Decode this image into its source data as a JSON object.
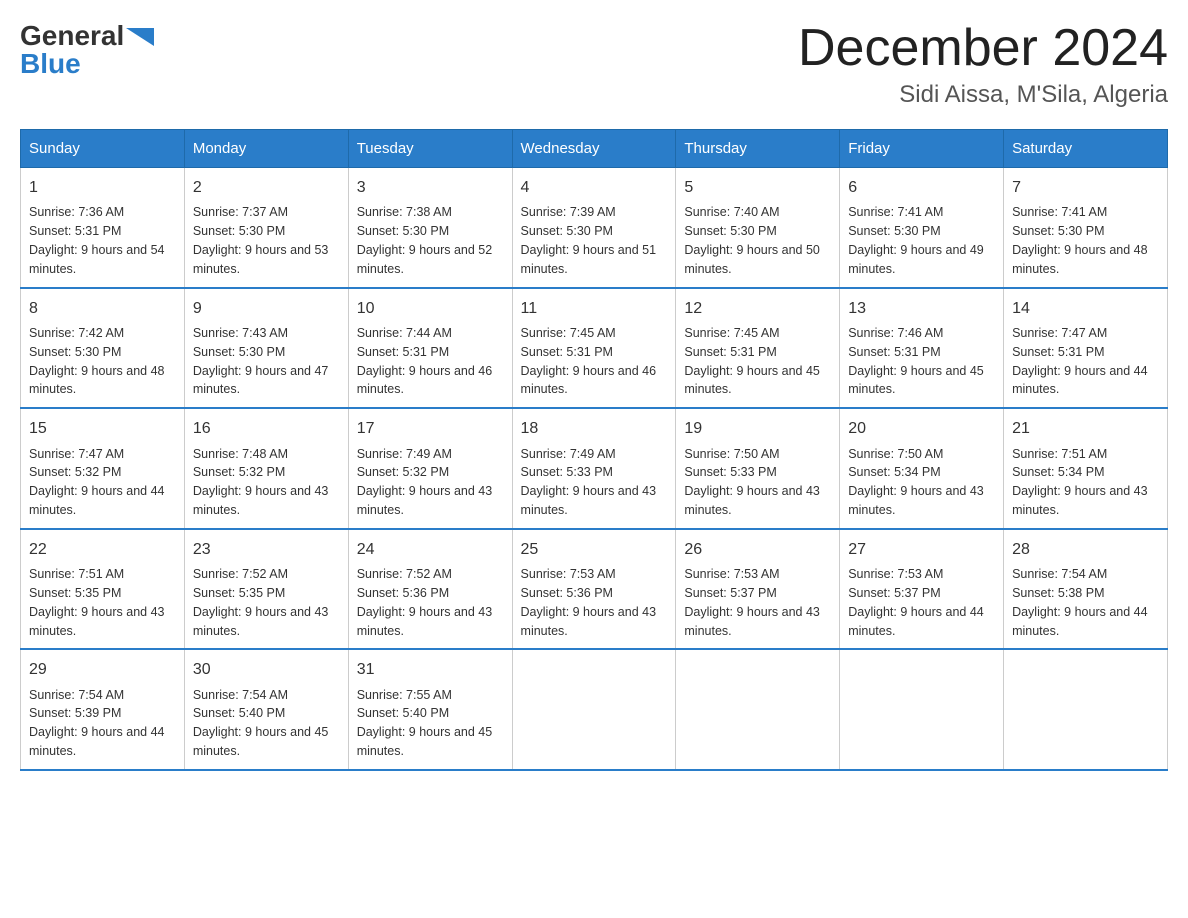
{
  "logo": {
    "general": "General",
    "blue": "Blue"
  },
  "title": "December 2024",
  "subtitle": "Sidi Aissa, M'Sila, Algeria",
  "days_header": [
    "Sunday",
    "Monday",
    "Tuesday",
    "Wednesday",
    "Thursday",
    "Friday",
    "Saturday"
  ],
  "weeks": [
    [
      {
        "day": "1",
        "sunrise": "7:36 AM",
        "sunset": "5:31 PM",
        "daylight": "9 hours and 54 minutes."
      },
      {
        "day": "2",
        "sunrise": "7:37 AM",
        "sunset": "5:30 PM",
        "daylight": "9 hours and 53 minutes."
      },
      {
        "day": "3",
        "sunrise": "7:38 AM",
        "sunset": "5:30 PM",
        "daylight": "9 hours and 52 minutes."
      },
      {
        "day": "4",
        "sunrise": "7:39 AM",
        "sunset": "5:30 PM",
        "daylight": "9 hours and 51 minutes."
      },
      {
        "day": "5",
        "sunrise": "7:40 AM",
        "sunset": "5:30 PM",
        "daylight": "9 hours and 50 minutes."
      },
      {
        "day": "6",
        "sunrise": "7:41 AM",
        "sunset": "5:30 PM",
        "daylight": "9 hours and 49 minutes."
      },
      {
        "day": "7",
        "sunrise": "7:41 AM",
        "sunset": "5:30 PM",
        "daylight": "9 hours and 48 minutes."
      }
    ],
    [
      {
        "day": "8",
        "sunrise": "7:42 AM",
        "sunset": "5:30 PM",
        "daylight": "9 hours and 48 minutes."
      },
      {
        "day": "9",
        "sunrise": "7:43 AM",
        "sunset": "5:30 PM",
        "daylight": "9 hours and 47 minutes."
      },
      {
        "day": "10",
        "sunrise": "7:44 AM",
        "sunset": "5:31 PM",
        "daylight": "9 hours and 46 minutes."
      },
      {
        "day": "11",
        "sunrise": "7:45 AM",
        "sunset": "5:31 PM",
        "daylight": "9 hours and 46 minutes."
      },
      {
        "day": "12",
        "sunrise": "7:45 AM",
        "sunset": "5:31 PM",
        "daylight": "9 hours and 45 minutes."
      },
      {
        "day": "13",
        "sunrise": "7:46 AM",
        "sunset": "5:31 PM",
        "daylight": "9 hours and 45 minutes."
      },
      {
        "day": "14",
        "sunrise": "7:47 AM",
        "sunset": "5:31 PM",
        "daylight": "9 hours and 44 minutes."
      }
    ],
    [
      {
        "day": "15",
        "sunrise": "7:47 AM",
        "sunset": "5:32 PM",
        "daylight": "9 hours and 44 minutes."
      },
      {
        "day": "16",
        "sunrise": "7:48 AM",
        "sunset": "5:32 PM",
        "daylight": "9 hours and 43 minutes."
      },
      {
        "day": "17",
        "sunrise": "7:49 AM",
        "sunset": "5:32 PM",
        "daylight": "9 hours and 43 minutes."
      },
      {
        "day": "18",
        "sunrise": "7:49 AM",
        "sunset": "5:33 PM",
        "daylight": "9 hours and 43 minutes."
      },
      {
        "day": "19",
        "sunrise": "7:50 AM",
        "sunset": "5:33 PM",
        "daylight": "9 hours and 43 minutes."
      },
      {
        "day": "20",
        "sunrise": "7:50 AM",
        "sunset": "5:34 PM",
        "daylight": "9 hours and 43 minutes."
      },
      {
        "day": "21",
        "sunrise": "7:51 AM",
        "sunset": "5:34 PM",
        "daylight": "9 hours and 43 minutes."
      }
    ],
    [
      {
        "day": "22",
        "sunrise": "7:51 AM",
        "sunset": "5:35 PM",
        "daylight": "9 hours and 43 minutes."
      },
      {
        "day": "23",
        "sunrise": "7:52 AM",
        "sunset": "5:35 PM",
        "daylight": "9 hours and 43 minutes."
      },
      {
        "day": "24",
        "sunrise": "7:52 AM",
        "sunset": "5:36 PM",
        "daylight": "9 hours and 43 minutes."
      },
      {
        "day": "25",
        "sunrise": "7:53 AM",
        "sunset": "5:36 PM",
        "daylight": "9 hours and 43 minutes."
      },
      {
        "day": "26",
        "sunrise": "7:53 AM",
        "sunset": "5:37 PM",
        "daylight": "9 hours and 43 minutes."
      },
      {
        "day": "27",
        "sunrise": "7:53 AM",
        "sunset": "5:37 PM",
        "daylight": "9 hours and 44 minutes."
      },
      {
        "day": "28",
        "sunrise": "7:54 AM",
        "sunset": "5:38 PM",
        "daylight": "9 hours and 44 minutes."
      }
    ],
    [
      {
        "day": "29",
        "sunrise": "7:54 AM",
        "sunset": "5:39 PM",
        "daylight": "9 hours and 44 minutes."
      },
      {
        "day": "30",
        "sunrise": "7:54 AM",
        "sunset": "5:40 PM",
        "daylight": "9 hours and 45 minutes."
      },
      {
        "day": "31",
        "sunrise": "7:55 AM",
        "sunset": "5:40 PM",
        "daylight": "9 hours and 45 minutes."
      },
      null,
      null,
      null,
      null
    ]
  ]
}
